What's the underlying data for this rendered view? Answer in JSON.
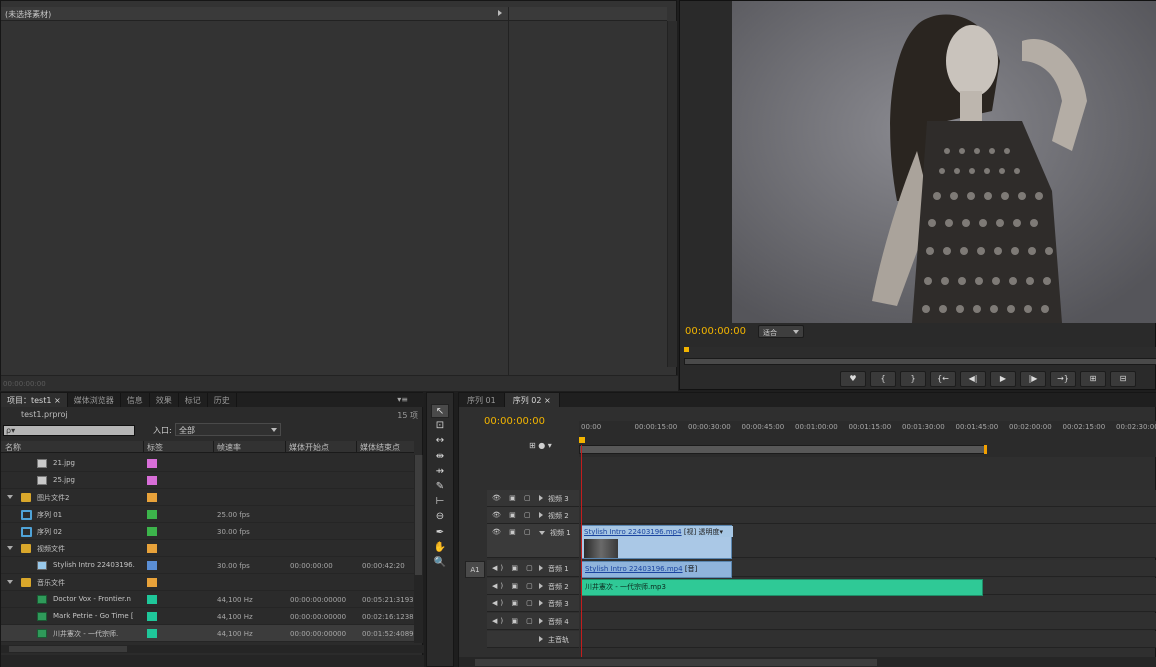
{
  "source_panel": {
    "title": "(未选择素材)",
    "timecode": "00:00:00:00"
  },
  "program_monitor": {
    "timecode": "00:00:00:00",
    "fit_label": "适合",
    "transport_buttons": [
      "♥",
      "{",
      "}",
      "{←",
      "◀|",
      "▶",
      "|▶",
      "→}",
      "⊞",
      "⊟"
    ]
  },
  "project_panel": {
    "tabs": [
      "项目：test1 ×",
      "媒体浏览器",
      "信息",
      "效果",
      "标记",
      "历史"
    ],
    "menu_glyph": "▾≡",
    "file_name": "test1.prproj",
    "item_count": "15 项",
    "search_placeholder": "ρ▾",
    "entry_label": "入口:",
    "entry_value": "全部",
    "columns": [
      "名称",
      "标签",
      "帧速率",
      "媒体开始点",
      "媒体结束点"
    ],
    "rows": [
      {
        "type": "img",
        "indent": 2,
        "name": "21.jpg",
        "label_color": "#d86ed8",
        "fps": "",
        "start": "",
        "end": ""
      },
      {
        "type": "img",
        "indent": 2,
        "name": "25.jpg",
        "label_color": "#d86ed8",
        "fps": "",
        "start": "",
        "end": ""
      },
      {
        "type": "folder",
        "indent": 1,
        "name": "图片文件2",
        "label_color": "#e8a23a",
        "fps": "",
        "start": "",
        "end": ""
      },
      {
        "type": "seq",
        "indent": 1,
        "name": "序列 01",
        "label_color": "#3cb44b",
        "fps": "25.00 fps",
        "start": "",
        "end": ""
      },
      {
        "type": "seq",
        "indent": 1,
        "name": "序列 02",
        "label_color": "#3cb44b",
        "fps": "30.00 fps",
        "start": "",
        "end": ""
      },
      {
        "type": "folder",
        "indent": 1,
        "name": "视频文件",
        "label_color": "#e8a23a",
        "fps": "",
        "start": "",
        "end": ""
      },
      {
        "type": "video",
        "indent": 2,
        "name": "Stylish Intro 22403196.",
        "label_color": "#5b8fd6",
        "fps": "30.00 fps",
        "start": "00:00:00:00",
        "end": "00:00:42:20"
      },
      {
        "type": "folder",
        "indent": 1,
        "name": "音乐文件",
        "label_color": "#e8a23a",
        "fps": "",
        "start": "",
        "end": ""
      },
      {
        "type": "audio",
        "indent": 2,
        "name": "Doctor Vox - Frontier.n",
        "label_color": "#1fc79a",
        "fps": "44,100 Hz",
        "start": "00:00:00:00000",
        "end": "00:05:21:3193"
      },
      {
        "type": "audio",
        "indent": 2,
        "name": "Mark Petrie - Go Time [",
        "label_color": "#1fc79a",
        "fps": "44,100 Hz",
        "start": "00:00:00:00000",
        "end": "00:02:16:1238"
      },
      {
        "type": "audio",
        "indent": 2,
        "name": "川井憲次 - 一代宗师.",
        "label_color": "#1fc79a",
        "fps": "44,100 Hz",
        "start": "00:00:00:00000",
        "end": "00:01:52:4089",
        "selected": true
      }
    ]
  },
  "tools": [
    "↖",
    "⊡",
    "↔",
    "⇹",
    "⇸",
    "✎",
    "⊢",
    "⊖",
    "✒",
    "✋",
    "🔍"
  ],
  "timeline": {
    "tabs": [
      "序列 01",
      "序列 02 ×"
    ],
    "timecode": "00:00:00:00",
    "ruler_ticks": [
      "00:00",
      "00:00:15:00",
      "00:00:30:00",
      "00:00:45:00",
      "00:01:00:00",
      "00:01:15:00",
      "00:01:30:00",
      "00:01:45:00",
      "00:02:00:00",
      "00:02:15:00",
      "00:02:30:00",
      "00:"
    ],
    "header_tools": "⊞ ● ▾",
    "a1_patch": "A1",
    "tracks": [
      {
        "name": "视频 3",
        "kind": "video"
      },
      {
        "name": "视频 2",
        "kind": "video"
      },
      {
        "name": "视频 1",
        "kind": "video",
        "expanded": true
      },
      {
        "name": "音频 1",
        "kind": "audio"
      },
      {
        "name": "音频 2",
        "kind": "audio"
      },
      {
        "name": "音频 3",
        "kind": "audio"
      },
      {
        "name": "音频 4",
        "kind": "audio"
      },
      {
        "name": "主音轨",
        "kind": "master"
      }
    ],
    "video_clip": {
      "name": "Stylish Intro 22403196.mp4",
      "suffix": "[视]",
      "effect": "透明度▾"
    },
    "audio_clip_1": {
      "name": "Stylish Intro 22403196.mp4",
      "suffix": "[音]"
    },
    "audio_clip_2": {
      "name": "川井憲次 - 一代宗师.mp3"
    }
  }
}
